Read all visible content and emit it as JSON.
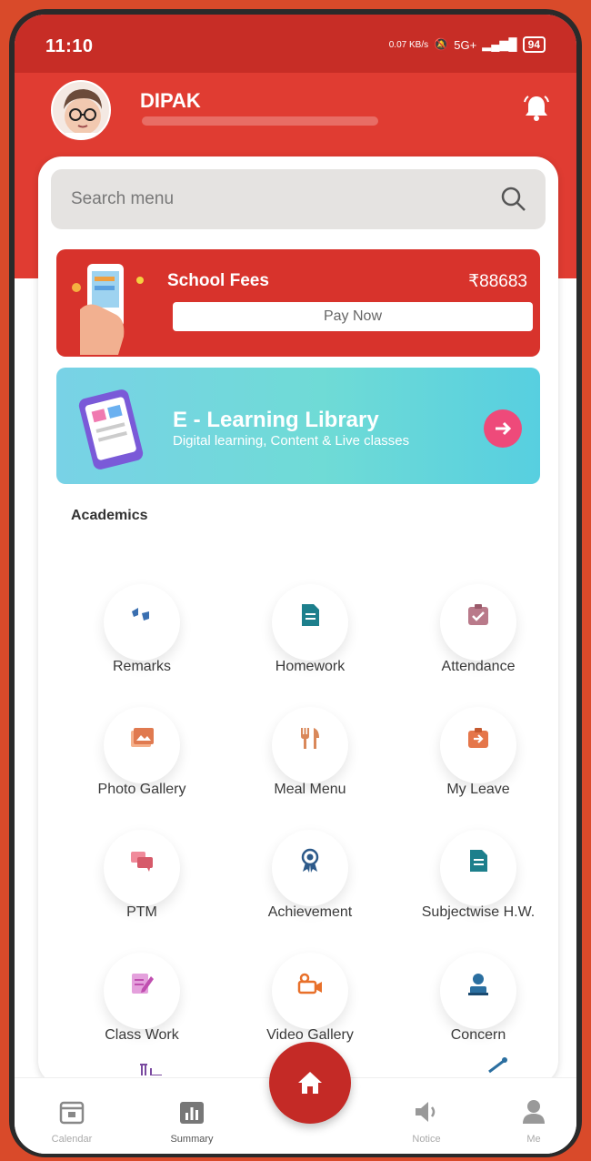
{
  "status_bar": {
    "time": "11:10",
    "net_speed": "0.07 KB/s",
    "network": "5G+",
    "battery": "94"
  },
  "header": {
    "user_name": "DIPAK",
    "bell_icon": "bell-icon"
  },
  "search": {
    "placeholder": "Search menu",
    "icon": "search-icon"
  },
  "fees_banner": {
    "title": "School Fees",
    "amount": "₹88683",
    "button_label": "Pay Now"
  },
  "elearning_banner": {
    "title": "E - Learning Library",
    "subtitle": "Digital learning, Content & Live classes",
    "icon": "arrow-right-icon"
  },
  "academics": {
    "heading": "Academics",
    "items": [
      {
        "label": "Remarks",
        "icon": "remarks-icon",
        "color": "#3a6fb0"
      },
      {
        "label": "Homework",
        "icon": "homework-icon",
        "color": "#1d7f8c"
      },
      {
        "label": "Attendance",
        "icon": "attendance-icon",
        "color": "#b97a8a"
      },
      {
        "label": "Photo Gallery",
        "icon": "photo-gallery-icon",
        "color": "#e07a50"
      },
      {
        "label": "Meal Menu",
        "icon": "meal-menu-icon",
        "color": "#d9885a"
      },
      {
        "label": "My Leave",
        "icon": "leave-icon",
        "color": "#e5764a"
      },
      {
        "label": "PTM",
        "icon": "ptm-icon",
        "color": "#d65a6a"
      },
      {
        "label": "Achievement",
        "icon": "achievement-icon",
        "color": "#2d5a8a"
      },
      {
        "label": "Subjectwise H.W.",
        "icon": "subject-homework-icon",
        "color": "#1d7f8c"
      },
      {
        "label": "Class Work",
        "icon": "class-work-icon",
        "color": "#c04fb0"
      },
      {
        "label": "Video Gallery",
        "icon": "video-gallery-icon",
        "color": "#e8702a"
      },
      {
        "label": "Concern",
        "icon": "concern-icon",
        "color": "#2b6fa0"
      }
    ]
  },
  "bottom_nav": {
    "items": [
      {
        "label": "Calendar",
        "icon": "calendar-icon"
      },
      {
        "label": "Summary",
        "icon": "summary-icon"
      },
      {
        "label": "Notice",
        "icon": "notice-icon"
      },
      {
        "label": "Me",
        "icon": "profile-icon"
      }
    ],
    "home_icon": "home-icon"
  }
}
